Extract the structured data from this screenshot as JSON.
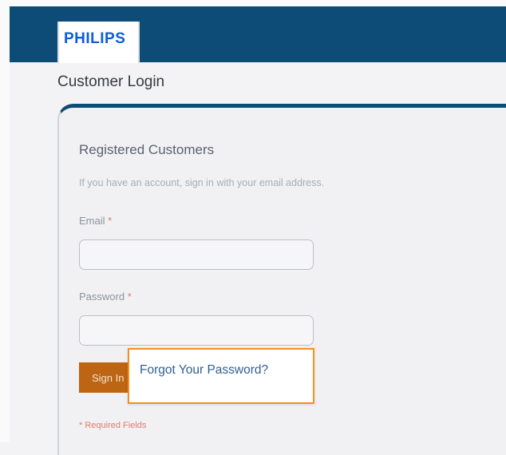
{
  "header": {
    "brand": "PHILIPS"
  },
  "page": {
    "title": "Customer Login"
  },
  "login_form": {
    "section_title": "Registered Customers",
    "description": "If you have an account, sign in with your email address.",
    "email": {
      "label": "Email",
      "value": "",
      "placeholder": ""
    },
    "password": {
      "label": "Password",
      "value": "",
      "placeholder": ""
    },
    "required_marker": "*",
    "signin_label": "Sign In",
    "required_note": "* Required Fields"
  },
  "tooltip": {
    "forgot_label": "Forgot Your Password?"
  },
  "colors": {
    "header_blue": "#0e4c78",
    "brand_blue": "#0b5ed7",
    "signin_orange": "#bd6512",
    "highlight_orange": "#f39221",
    "required_red": "#e07a6c",
    "link_blue": "#2f5f91"
  }
}
